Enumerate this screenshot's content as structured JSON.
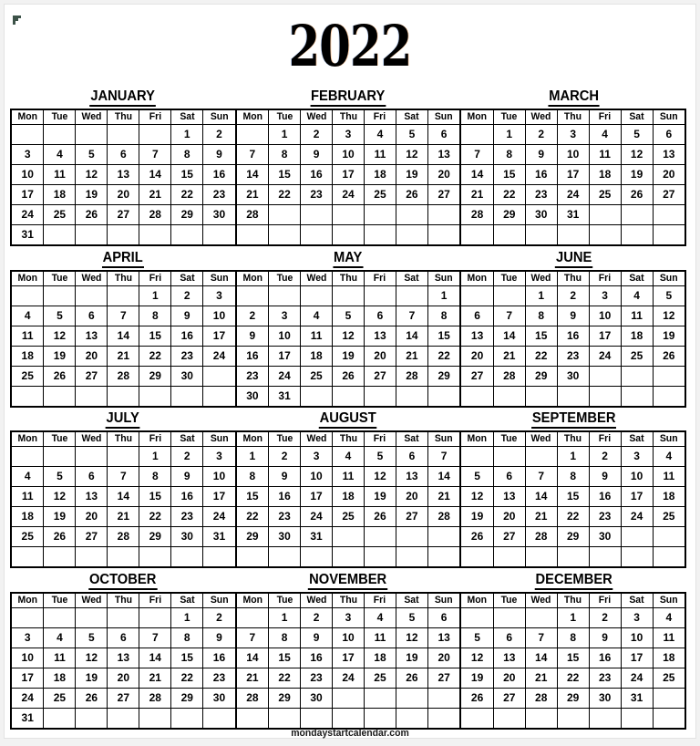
{
  "page": {
    "year_title": "2022",
    "footer_text": "mondaystartcalendar.com",
    "background_color": "#ffffff",
    "page_backdrop_color": "#f2f2f2",
    "text_color": "#000000",
    "grid_line_color": "#000000",
    "corner_mark_color": "#3c5248",
    "weekday_headers": [
      "Mon",
      "Tue",
      "Wed",
      "Thu",
      "Fri",
      "Sat",
      "Sun"
    ],
    "week_start": "Mon"
  },
  "quarters": [
    {
      "id": "q1",
      "months": [
        {
          "name": "JANUARY",
          "weeks": [
            [
              "",
              "",
              "",
              "",
              "",
              "1",
              "2"
            ],
            [
              "3",
              "4",
              "5",
              "6",
              "7",
              "8",
              "9"
            ],
            [
              "10",
              "11",
              "12",
              "13",
              "14",
              "15",
              "16"
            ],
            [
              "17",
              "18",
              "19",
              "20",
              "21",
              "22",
              "23"
            ],
            [
              "24",
              "25",
              "26",
              "27",
              "28",
              "29",
              "30"
            ],
            [
              "31",
              "",
              "",
              "",
              "",
              "",
              ""
            ]
          ]
        },
        {
          "name": "FEBRUARY",
          "weeks": [
            [
              "",
              "1",
              "2",
              "3",
              "4",
              "5",
              "6"
            ],
            [
              "7",
              "8",
              "9",
              "10",
              "11",
              "12",
              "13"
            ],
            [
              "14",
              "15",
              "16",
              "17",
              "18",
              "19",
              "20"
            ],
            [
              "21",
              "22",
              "23",
              "24",
              "25",
              "26",
              "27"
            ],
            [
              "28",
              "",
              "",
              "",
              "",
              "",
              ""
            ],
            [
              "",
              "",
              "",
              "",
              "",
              "",
              ""
            ]
          ]
        },
        {
          "name": "MARCH",
          "weeks": [
            [
              "",
              "1",
              "2",
              "3",
              "4",
              "5",
              "6"
            ],
            [
              "7",
              "8",
              "9",
              "10",
              "11",
              "12",
              "13"
            ],
            [
              "14",
              "15",
              "16",
              "17",
              "18",
              "19",
              "20"
            ],
            [
              "21",
              "22",
              "23",
              "24",
              "25",
              "26",
              "27"
            ],
            [
              "28",
              "29",
              "30",
              "31",
              "",
              "",
              ""
            ],
            [
              "",
              "",
              "",
              "",
              "",
              "",
              ""
            ]
          ]
        }
      ]
    },
    {
      "id": "q2",
      "months": [
        {
          "name": "APRIL",
          "weeks": [
            [
              "",
              "",
              "",
              "",
              "1",
              "2",
              "3"
            ],
            [
              "4",
              "5",
              "6",
              "7",
              "8",
              "9",
              "10"
            ],
            [
              "11",
              "12",
              "13",
              "14",
              "15",
              "16",
              "17"
            ],
            [
              "18",
              "19",
              "20",
              "21",
              "22",
              "23",
              "24"
            ],
            [
              "25",
              "26",
              "27",
              "28",
              "29",
              "30",
              ""
            ],
            [
              "",
              "",
              "",
              "",
              "",
              "",
              ""
            ]
          ]
        },
        {
          "name": "MAY",
          "weeks": [
            [
              "",
              "",
              "",
              "",
              "",
              "",
              "1"
            ],
            [
              "2",
              "3",
              "4",
              "5",
              "6",
              "7",
              "8"
            ],
            [
              "9",
              "10",
              "11",
              "12",
              "13",
              "14",
              "15"
            ],
            [
              "16",
              "17",
              "18",
              "19",
              "20",
              "21",
              "22"
            ],
            [
              "23",
              "24",
              "25",
              "26",
              "27",
              "28",
              "29"
            ],
            [
              "30",
              "31",
              "",
              "",
              "",
              "",
              ""
            ]
          ]
        },
        {
          "name": "JUNE",
          "weeks": [
            [
              "",
              "",
              "1",
              "2",
              "3",
              "4",
              "5"
            ],
            [
              "6",
              "7",
              "8",
              "9",
              "10",
              "11",
              "12"
            ],
            [
              "13",
              "14",
              "15",
              "16",
              "17",
              "18",
              "19"
            ],
            [
              "20",
              "21",
              "22",
              "23",
              "24",
              "25",
              "26"
            ],
            [
              "27",
              "28",
              "29",
              "30",
              "",
              "",
              ""
            ],
            [
              "",
              "",
              "",
              "",
              "",
              "",
              ""
            ]
          ]
        }
      ]
    },
    {
      "id": "q3",
      "months": [
        {
          "name": "JULY",
          "weeks": [
            [
              "",
              "",
              "",
              "",
              "1",
              "2",
              "3"
            ],
            [
              "4",
              "5",
              "6",
              "7",
              "8",
              "9",
              "10"
            ],
            [
              "11",
              "12",
              "13",
              "14",
              "15",
              "16",
              "17"
            ],
            [
              "18",
              "19",
              "20",
              "21",
              "22",
              "23",
              "24"
            ],
            [
              "25",
              "26",
              "27",
              "28",
              "29",
              "30",
              "31"
            ],
            [
              "",
              "",
              "",
              "",
              "",
              "",
              ""
            ]
          ]
        },
        {
          "name": "AUGUST",
          "weeks": [
            [
              "1",
              "2",
              "3",
              "4",
              "5",
              "6",
              "7"
            ],
            [
              "8",
              "9",
              "10",
              "11",
              "12",
              "13",
              "14"
            ],
            [
              "15",
              "16",
              "17",
              "18",
              "19",
              "20",
              "21"
            ],
            [
              "22",
              "23",
              "24",
              "25",
              "26",
              "27",
              "28"
            ],
            [
              "29",
              "30",
              "31",
              "",
              "",
              "",
              ""
            ],
            [
              "",
              "",
              "",
              "",
              "",
              "",
              ""
            ]
          ]
        },
        {
          "name": "SEPTEMBER",
          "weeks": [
            [
              "",
              "",
              "",
              "1",
              "2",
              "3",
              "4"
            ],
            [
              "5",
              "6",
              "7",
              "8",
              "9",
              "10",
              "11"
            ],
            [
              "12",
              "13",
              "14",
              "15",
              "16",
              "17",
              "18"
            ],
            [
              "19",
              "20",
              "21",
              "22",
              "23",
              "24",
              "25"
            ],
            [
              "26",
              "27",
              "28",
              "29",
              "30",
              "",
              ""
            ],
            [
              "",
              "",
              "",
              "",
              "",
              "",
              ""
            ]
          ]
        }
      ]
    },
    {
      "id": "q4",
      "months": [
        {
          "name": "OCTOBER",
          "weeks": [
            [
              "",
              "",
              "",
              "",
              "",
              "1",
              "2"
            ],
            [
              "3",
              "4",
              "5",
              "6",
              "7",
              "8",
              "9"
            ],
            [
              "10",
              "11",
              "12",
              "13",
              "14",
              "15",
              "16"
            ],
            [
              "17",
              "18",
              "19",
              "20",
              "21",
              "22",
              "23"
            ],
            [
              "24",
              "25",
              "26",
              "27",
              "28",
              "29",
              "30"
            ],
            [
              "31",
              "",
              "",
              "",
              "",
              "",
              ""
            ]
          ]
        },
        {
          "name": "NOVEMBER",
          "weeks": [
            [
              "",
              "1",
              "2",
              "3",
              "4",
              "5",
              "6"
            ],
            [
              "7",
              "8",
              "9",
              "10",
              "11",
              "12",
              "13"
            ],
            [
              "14",
              "15",
              "16",
              "17",
              "18",
              "19",
              "20"
            ],
            [
              "21",
              "22",
              "23",
              "24",
              "25",
              "26",
              "27"
            ],
            [
              "28",
              "29",
              "30",
              "",
              "",
              "",
              ""
            ],
            [
              "",
              "",
              "",
              "",
              "",
              "",
              ""
            ]
          ]
        },
        {
          "name": "DECEMBER",
          "weeks": [
            [
              "",
              "",
              "",
              "1",
              "2",
              "3",
              "4"
            ],
            [
              "5",
              "6",
              "7",
              "8",
              "9",
              "10",
              "11"
            ],
            [
              "12",
              "13",
              "14",
              "15",
              "16",
              "17",
              "18"
            ],
            [
              "19",
              "20",
              "21",
              "22",
              "23",
              "24",
              "25"
            ],
            [
              "26",
              "27",
              "28",
              "29",
              "30",
              "31",
              ""
            ],
            [
              "",
              "",
              "",
              "",
              "",
              "",
              ""
            ]
          ]
        }
      ]
    }
  ]
}
